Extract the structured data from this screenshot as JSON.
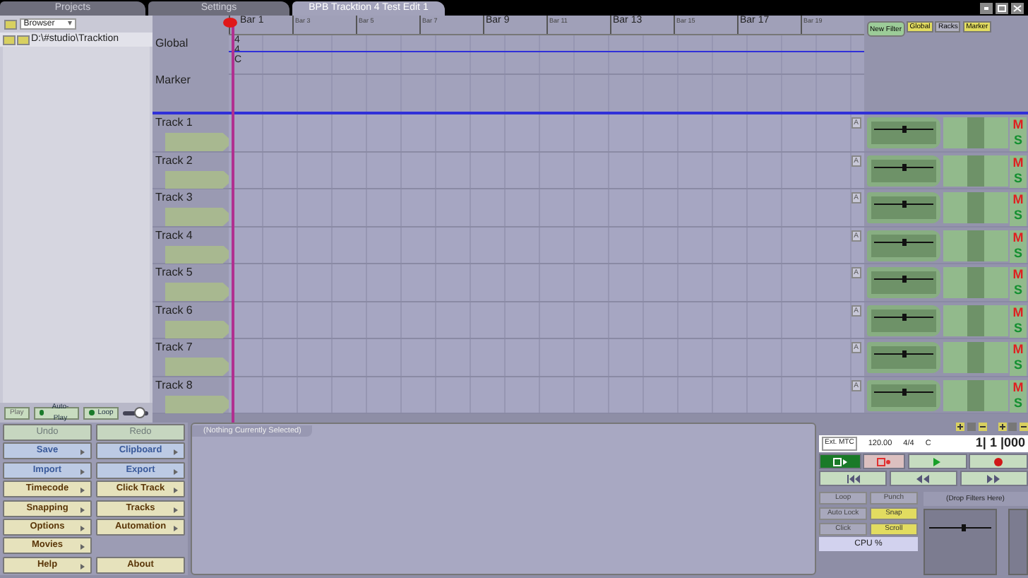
{
  "tabs": [
    {
      "label": "Projects",
      "selected": false
    },
    {
      "label": "Settings",
      "selected": false
    },
    {
      "label": "BPB Tracktion 4 Test Edit 1",
      "selected": true
    }
  ],
  "browser": {
    "source": "Browser",
    "path": "D:\\#studio\\Tracktion"
  },
  "preview": [
    {
      "label": "Play",
      "on": false
    },
    {
      "label": "Auto-Play",
      "on": true
    },
    {
      "label": "Loop",
      "on": true
    }
  ],
  "preview_volume": {
    "level": 0.65
  },
  "ruler": [
    {
      "label": "Bar 1",
      "major": true
    },
    {
      "label": "Bar 3",
      "major": false
    },
    {
      "label": "Bar 5",
      "major": false
    },
    {
      "label": "Bar 7",
      "major": false
    },
    {
      "label": "Bar 9",
      "major": true
    },
    {
      "label": "Bar 11",
      "major": false
    },
    {
      "label": "Bar 13",
      "major": true
    },
    {
      "label": "Bar 15",
      "major": false
    },
    {
      "label": "Bar 17",
      "major": true
    },
    {
      "label": "Bar 19",
      "major": false
    }
  ],
  "global": {
    "label": "Global",
    "values": [
      "4",
      "4",
      "C"
    ]
  },
  "marker": {
    "label": "Marker"
  },
  "filter_header": {
    "new_filter": "New Filter",
    "views": [
      {
        "label": "Global",
        "on": true
      },
      {
        "label": "Racks",
        "on": false
      },
      {
        "label": "Marker",
        "on": true
      }
    ]
  },
  "tracks": [
    {
      "name": "Track 1",
      "auto": "A",
      "level": 0.5,
      "mute": "M",
      "solo": "S"
    },
    {
      "name": "Track 2",
      "auto": "A",
      "level": 0.5,
      "mute": "M",
      "solo": "S"
    },
    {
      "name": "Track 3",
      "auto": "A",
      "level": 0.5,
      "mute": "M",
      "solo": "S"
    },
    {
      "name": "Track 4",
      "auto": "A",
      "level": 0.5,
      "mute": "M",
      "solo": "S"
    },
    {
      "name": "Track 5",
      "auto": "A",
      "level": 0.5,
      "mute": "M",
      "solo": "S"
    },
    {
      "name": "Track 6",
      "auto": "A",
      "level": 0.5,
      "mute": "M",
      "solo": "S"
    },
    {
      "name": "Track 7",
      "auto": "A",
      "level": 0.5,
      "mute": "M",
      "solo": "S"
    },
    {
      "name": "Track 8",
      "auto": "A",
      "level": 0.5,
      "mute": "M",
      "solo": "S"
    }
  ],
  "edit_buttons": [
    [
      {
        "label": "Undo",
        "kind": "edit",
        "disabled": true,
        "menu": false
      },
      {
        "label": "Redo",
        "kind": "edit",
        "disabled": true,
        "menu": false
      }
    ],
    [
      {
        "label": "Save",
        "kind": "file",
        "disabled": false,
        "menu": true
      },
      {
        "label": "Clipboard",
        "kind": "file",
        "disabled": false,
        "menu": true
      }
    ],
    [
      {
        "label": "Import",
        "kind": "file",
        "disabled": false,
        "menu": true
      },
      {
        "label": "Export",
        "kind": "file",
        "disabled": false,
        "menu": true
      }
    ],
    [
      {
        "label": "Timecode",
        "kind": "tool",
        "disabled": false,
        "menu": true
      },
      {
        "label": "Click Track",
        "kind": "tool",
        "disabled": false,
        "menu": true
      }
    ],
    [
      {
        "label": "Snapping",
        "kind": "tool",
        "disabled": false,
        "menu": true
      },
      {
        "label": "Tracks",
        "kind": "tool",
        "disabled": false,
        "menu": true
      }
    ],
    [
      {
        "label": "Options",
        "kind": "tool",
        "disabled": false,
        "menu": true
      },
      {
        "label": "Automation",
        "kind": "tool",
        "disabled": false,
        "menu": true
      }
    ],
    [
      {
        "label": "Movies",
        "kind": "tool",
        "disabled": false,
        "menu": true
      }
    ],
    [
      {
        "label": "Help",
        "kind": "tool",
        "disabled": false,
        "menu": true
      },
      {
        "label": "About",
        "kind": "tool",
        "disabled": false,
        "menu": false
      }
    ]
  ],
  "properties": {
    "title": "(Nothing Currently Selected)"
  },
  "transport": {
    "sync": "Ext. MTC",
    "tempo": "120.00",
    "time_sig": "4/4",
    "key": "C",
    "position": "1| 1 |000",
    "sync_play_on": true
  },
  "toggles": [
    {
      "label": "Loop",
      "on": false
    },
    {
      "label": "Punch",
      "on": false
    },
    {
      "label": "Auto Lock",
      "on": false
    },
    {
      "label": "Snap",
      "on": true
    },
    {
      "label": "Click",
      "on": false
    },
    {
      "label": "Scroll",
      "on": true
    }
  ],
  "cpu": "CPU %",
  "master": {
    "drop_hint": "(Drop Filters Here)",
    "level": 0.55
  }
}
